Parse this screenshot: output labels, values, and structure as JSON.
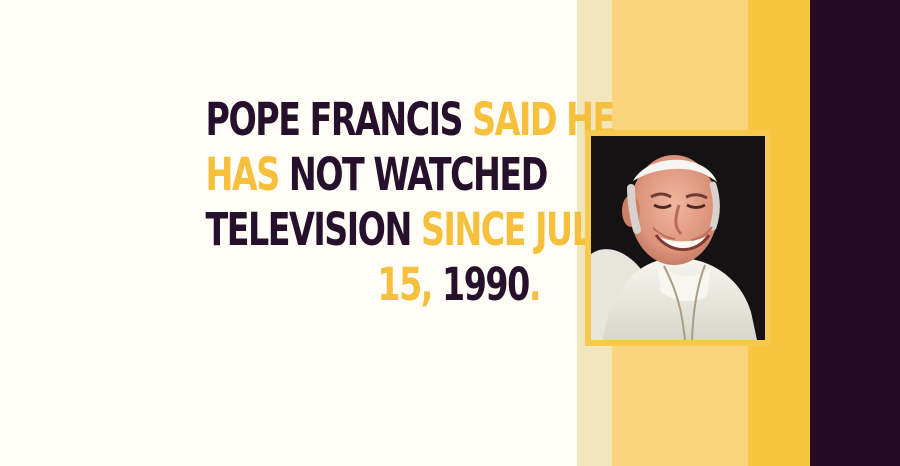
{
  "fact": {
    "lines": [
      [
        {
          "text": "POPE FRANCIS ",
          "tone": "dark"
        },
        {
          "text": "SAID HE",
          "tone": "accent"
        }
      ],
      [
        {
          "text": "HAS ",
          "tone": "accent"
        },
        {
          "text": "NOT WATCHED",
          "tone": "dark"
        }
      ],
      [
        {
          "text": "TELEVISION ",
          "tone": "dark"
        },
        {
          "text": "SINCE JULY",
          "tone": "accent"
        }
      ],
      [
        {
          "text": "15, ",
          "tone": "accent"
        },
        {
          "text": "1990",
          "tone": "dark"
        },
        {
          "text": ".",
          "tone": "accent"
        }
      ]
    ]
  },
  "photo": {
    "subject": "portrait of Pope Francis smiling, wearing white zucchetto and cassock",
    "icon": "person-portrait"
  },
  "colors": {
    "background": "#fffdf6",
    "text_dark": "#27102b",
    "text_accent": "#f6bf3c",
    "stripe_cream": "#f2e6bd",
    "stripe_light_yellow": "#f9d47a",
    "stripe_gold": "#f8c53f",
    "stripe_plum": "#260b27",
    "photo_frame": "#f7c94d"
  }
}
